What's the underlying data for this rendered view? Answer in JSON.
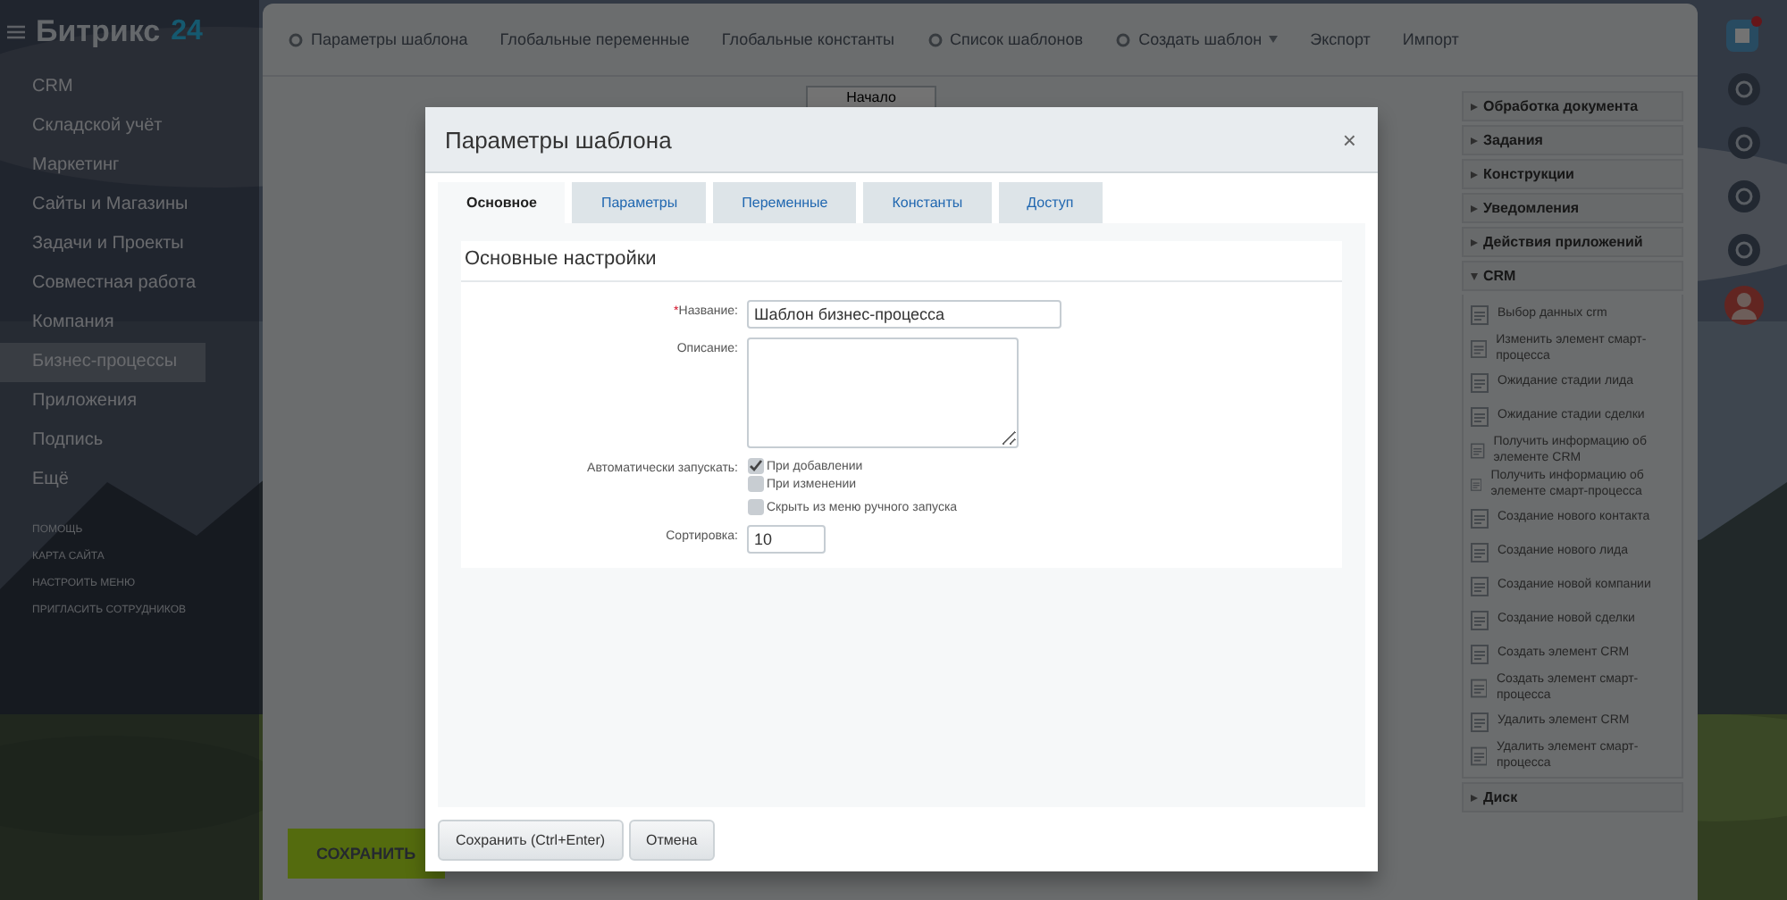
{
  "sidebar": {
    "logo": "Битрикс",
    "logo_badge": "24",
    "items": [
      {
        "label": "CRM",
        "selected": false
      },
      {
        "label": "Складской учёт",
        "selected": false
      },
      {
        "label": "Маркетинг",
        "selected": false
      },
      {
        "label": "Сайты и Магазины",
        "selected": false
      },
      {
        "label": "Задачи и Проекты",
        "selected": false
      },
      {
        "label": "Совместная работа",
        "selected": false
      },
      {
        "label": "Компания",
        "selected": false
      },
      {
        "label": "Бизнес-процессы",
        "selected": true
      },
      {
        "label": "Приложения",
        "selected": false
      },
      {
        "label": "Подпись",
        "selected": false
      },
      {
        "label": "Ещё",
        "selected": false
      }
    ],
    "footer_links": [
      "ПОМОЩЬ",
      "КАРТА САЙТА",
      "НАСТРОИТЬ МЕНЮ",
      "ПРИГЛАСИТЬ СОТРУДНИКОВ"
    ]
  },
  "toolbar": {
    "items": [
      {
        "label": "Параметры шаблона",
        "has_icon": true,
        "has_menu": false
      },
      {
        "label": "Глобальные переменные",
        "has_icon": false,
        "has_menu": false
      },
      {
        "label": "Глобальные константы",
        "has_icon": false,
        "has_menu": false
      },
      {
        "label": "Список шаблонов",
        "has_icon": true,
        "has_menu": false
      },
      {
        "label": "Создать шаблон",
        "has_icon": true,
        "has_menu": true
      },
      {
        "label": "Экспорт",
        "has_icon": false,
        "has_menu": false
      },
      {
        "label": "Импорт",
        "has_icon": false,
        "has_menu": false
      }
    ]
  },
  "canvas": {
    "start_block": "Начало",
    "save_button": "СОХРАНИТЬ"
  },
  "palette": {
    "groups": [
      {
        "label": "Обработка документа",
        "expanded": false
      },
      {
        "label": "Задания",
        "expanded": false
      },
      {
        "label": "Конструкции",
        "expanded": false
      },
      {
        "label": "Уведомления",
        "expanded": false
      },
      {
        "label": "Действия приложений",
        "expanded": false
      },
      {
        "label": "CRM",
        "expanded": true,
        "children": [
          "Выбор данных crm",
          "Изменить элемент смарт-процесса",
          "Ожидание стадии лида",
          "Ожидание стадии сделки",
          "Получить информацию об элементе CRM",
          "Получить информацию об элементе смарт-процесса",
          "Создание нового контакта",
          "Создание нового лида",
          "Создание новой компании",
          "Создание новой сделки",
          "Создать элемент CRM",
          "Создать элемент смарт-процесса",
          "Удалить элемент CRM",
          "Удалить элемент смарт-процесса"
        ]
      },
      {
        "label": "Диск",
        "expanded": false
      }
    ]
  },
  "dialog": {
    "title": "Параметры шаблона",
    "close": "×",
    "tabs": [
      {
        "label": "Основное",
        "selected": true
      },
      {
        "label": "Параметры",
        "selected": false
      },
      {
        "label": "Переменные",
        "selected": false
      },
      {
        "label": "Константы",
        "selected": false
      },
      {
        "label": "Доступ",
        "selected": false
      }
    ],
    "section_title": "Основные настройки",
    "name": {
      "required_mark": "*",
      "label": "Название:",
      "value": "Шаблон бизнес-процесса"
    },
    "description": {
      "label": "Описание:"
    },
    "auto_start": {
      "label": "Автоматически запускать:",
      "options": [
        {
          "label": "При добавлении",
          "checked": true
        },
        {
          "label": "При изменении",
          "checked": false
        }
      ]
    },
    "hide_manual": {
      "label": "Скрыть из меню ручного запуска",
      "checked": false
    },
    "sort": {
      "label": "Сортировка:",
      "value": "10"
    },
    "buttons": [
      "Сохранить (Ctrl+Enter)",
      "Отмена"
    ]
  }
}
